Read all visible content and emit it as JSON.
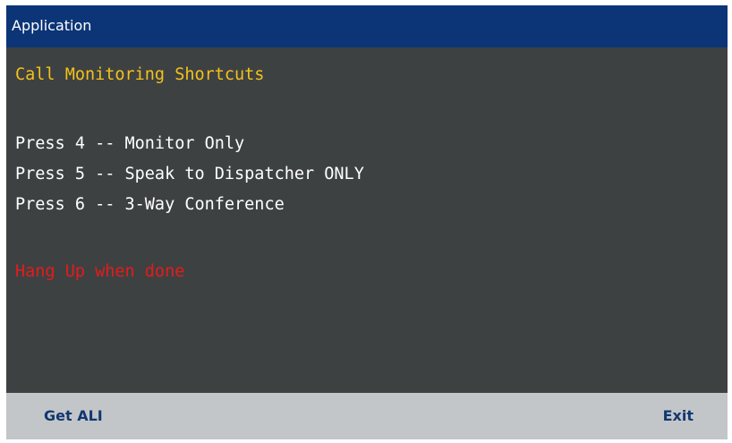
{
  "window": {
    "title": "Application"
  },
  "content": {
    "heading": "Call Monitoring Shortcuts",
    "options": [
      "Press 4 -- Monitor Only",
      "Press 5 -- Speak to Dispatcher ONLY",
      "Press 6 -- 3-Way Conference"
    ],
    "note": "Hang Up when done"
  },
  "softkeys": {
    "left_label": "Get ALI",
    "right_label": "Exit"
  },
  "colors": {
    "titlebar": "#0b3576",
    "background": "#3e4142",
    "heading": "#f3c21a",
    "option_text": "#ffffff",
    "note": "#e51b1b",
    "softkey_bar": "#c3c6c9",
    "softkey_text": "#13386f"
  }
}
